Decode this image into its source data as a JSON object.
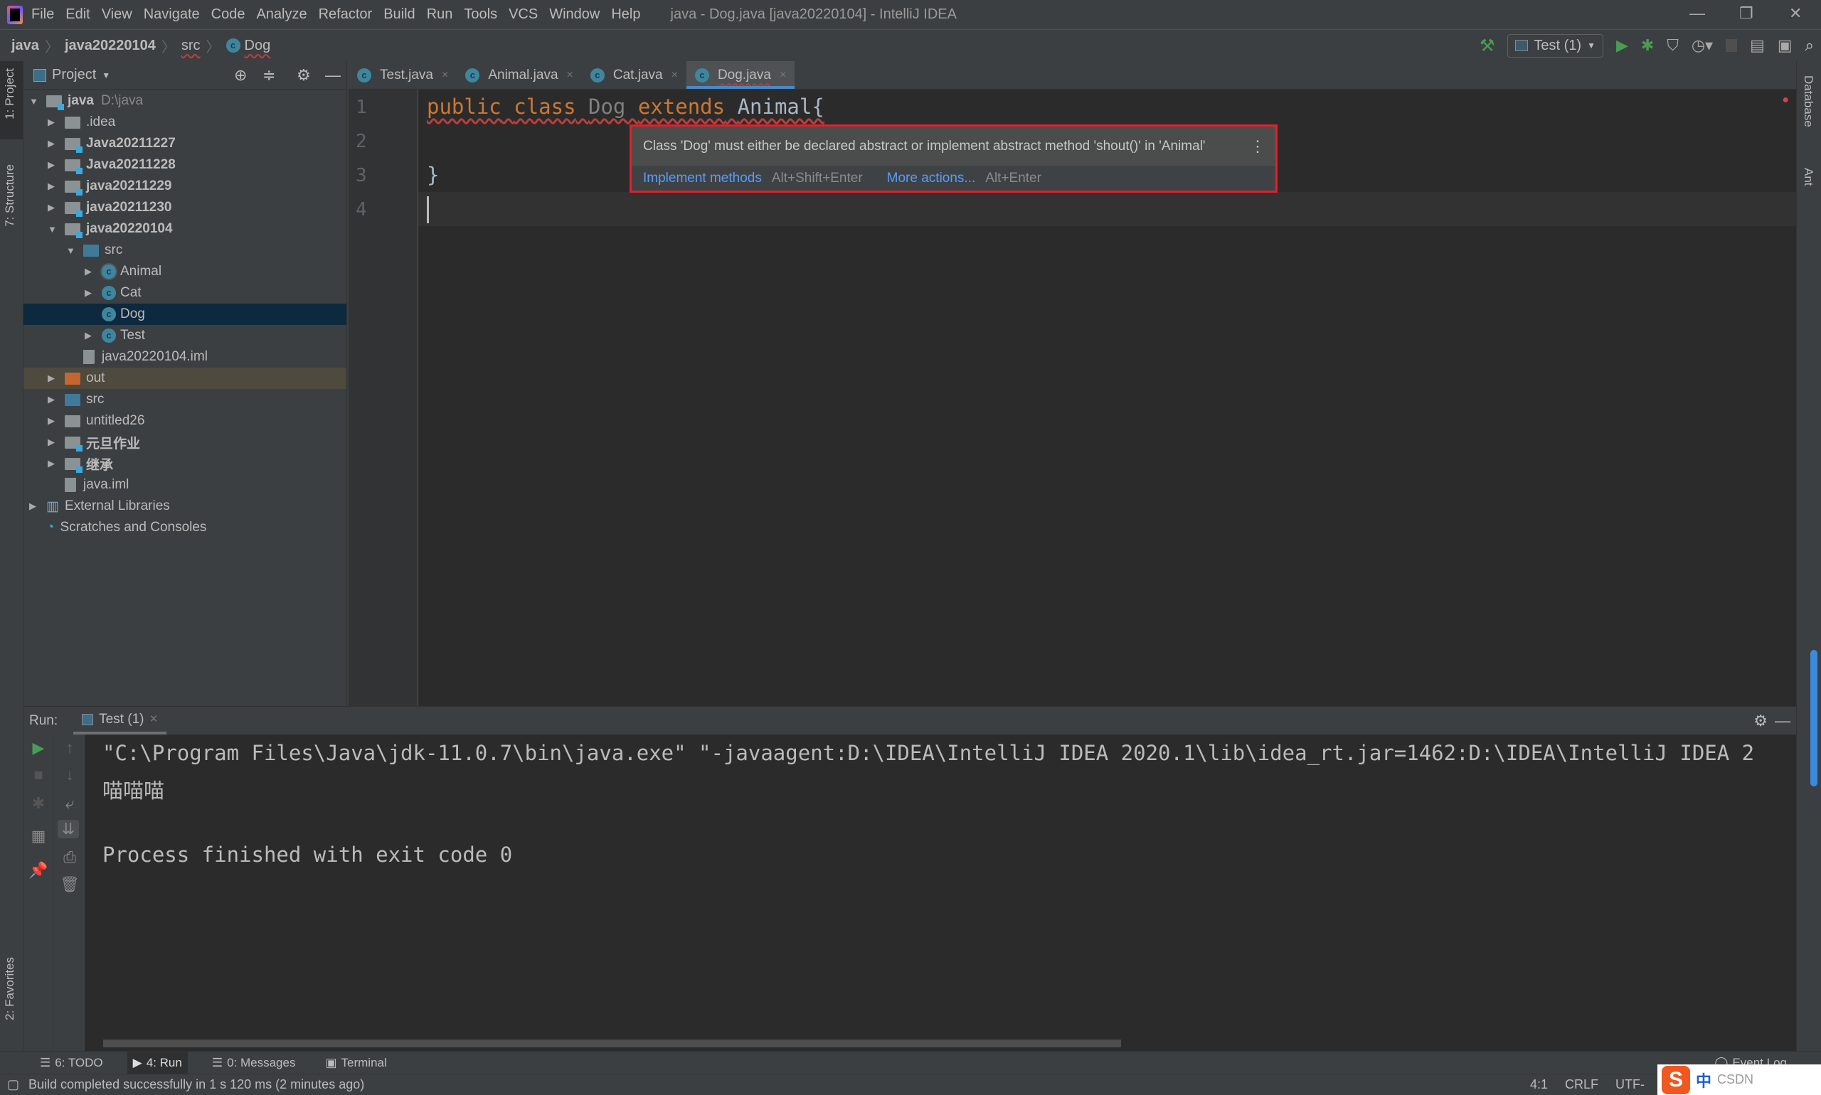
{
  "window": {
    "title": "java - Dog.java [java20220104] - IntelliJ IDEA",
    "minimize": "—",
    "restore": "❐",
    "close": "✕"
  },
  "menu": [
    "File",
    "Edit",
    "View",
    "Navigate",
    "Code",
    "Analyze",
    "Refactor",
    "Build",
    "Run",
    "Tools",
    "VCS",
    "Window",
    "Help"
  ],
  "breadcrumb": [
    "java",
    "java20220104",
    "src",
    "Dog"
  ],
  "toolbar": {
    "run_config": "Test (1)"
  },
  "left_strip": [
    "1: Project",
    "7: Structure",
    "2: Favorites"
  ],
  "right_strip": [
    "Database",
    "Ant"
  ],
  "project": {
    "title": "Project",
    "tree": [
      {
        "label": "java",
        "hint": "D:\\java",
        "level": 0,
        "arrow": "▼",
        "icon": "module-folder",
        "bold": true
      },
      {
        "label": ".idea",
        "level": 1,
        "arrow": "▶",
        "icon": "folder"
      },
      {
        "label": "Java20211227",
        "level": 1,
        "arrow": "▶",
        "icon": "module-folder",
        "bold": true
      },
      {
        "label": "Java20211228",
        "level": 1,
        "arrow": "▶",
        "icon": "module-folder",
        "bold": true
      },
      {
        "label": "java20211229",
        "level": 1,
        "arrow": "▶",
        "icon": "module-folder",
        "bold": true
      },
      {
        "label": "java20211230",
        "level": 1,
        "arrow": "▶",
        "icon": "module-folder",
        "bold": true
      },
      {
        "label": "java20220104",
        "level": 1,
        "arrow": "▼",
        "icon": "module-folder",
        "bold": true
      },
      {
        "label": "src",
        "level": 2,
        "arrow": "▼",
        "icon": "source-folder"
      },
      {
        "label": "Animal",
        "level": 3,
        "arrow": "▶",
        "icon": "abstract-class"
      },
      {
        "label": "Cat",
        "level": 3,
        "arrow": "▶",
        "icon": "class"
      },
      {
        "label": "Dog",
        "level": 3,
        "arrow": "",
        "icon": "class",
        "selected": true
      },
      {
        "label": "Test",
        "level": 3,
        "arrow": "▶",
        "icon": "runnable-class"
      },
      {
        "label": "java20220104.iml",
        "level": 2,
        "arrow": "",
        "icon": "iml-file"
      },
      {
        "label": "out",
        "level": 1,
        "arrow": "▶",
        "icon": "excluded-folder",
        "highlight": true
      },
      {
        "label": "src",
        "level": 1,
        "arrow": "▶",
        "icon": "source-folder"
      },
      {
        "label": "untitled26",
        "level": 1,
        "arrow": "▶",
        "icon": "folder"
      },
      {
        "label": "元旦作业",
        "level": 1,
        "arrow": "▶",
        "icon": "module-folder",
        "bold": true
      },
      {
        "label": "继承",
        "level": 1,
        "arrow": "▶",
        "icon": "module-folder",
        "bold": true
      },
      {
        "label": "java.iml",
        "level": 1,
        "arrow": "",
        "icon": "iml-file"
      },
      {
        "label": "External Libraries",
        "level": 0,
        "arrow": "▶",
        "icon": "library"
      },
      {
        "label": "Scratches and Consoles",
        "level": 0,
        "arrow": "",
        "icon": "scratches"
      }
    ]
  },
  "editor": {
    "tabs": [
      {
        "label": "Test.java"
      },
      {
        "label": "Animal.java"
      },
      {
        "label": "Cat.java"
      },
      {
        "label": "Dog.java",
        "active": true
      }
    ],
    "line_numbers": [
      "1",
      "2",
      "3",
      "4"
    ],
    "code": {
      "l1_kw1": "public",
      "l1_kw2": "class",
      "l1_name": "Dog",
      "l1_kw3": "extends",
      "l1_super": "Animal{",
      "l3": "}"
    }
  },
  "popup": {
    "message": "Class 'Dog' must either be declared abstract or implement abstract method 'shout()' in 'Animal'",
    "action1": "Implement methods",
    "action1_key": "Alt+Shift+Enter",
    "action2": "More actions...",
    "action2_key": "Alt+Enter",
    "border_color": "#e3202a"
  },
  "run": {
    "label": "Run:",
    "tab": "Test (1)",
    "output": [
      "\"C:\\Program Files\\Java\\jdk-11.0.7\\bin\\java.exe\" \"-javaagent:D:\\IDEA\\IntelliJ IDEA 2020.1\\lib\\idea_rt.jar=1462:D:\\IDEA\\IntelliJ IDEA 2",
      "喵喵喵",
      "",
      "Process finished with exit code 0"
    ]
  },
  "bottom_tabs": [
    "6: TODO",
    "4: Run",
    "0: Messages",
    "Terminal"
  ],
  "event_log": "Event Log",
  "status": {
    "message": "Build completed successfully in 1 s 120 ms (2 minutes ago)",
    "position": "4:1",
    "line_sep": "CRLF",
    "encoding": "UTF-"
  },
  "ime": {
    "lang": "中",
    "text": "CSDN"
  }
}
